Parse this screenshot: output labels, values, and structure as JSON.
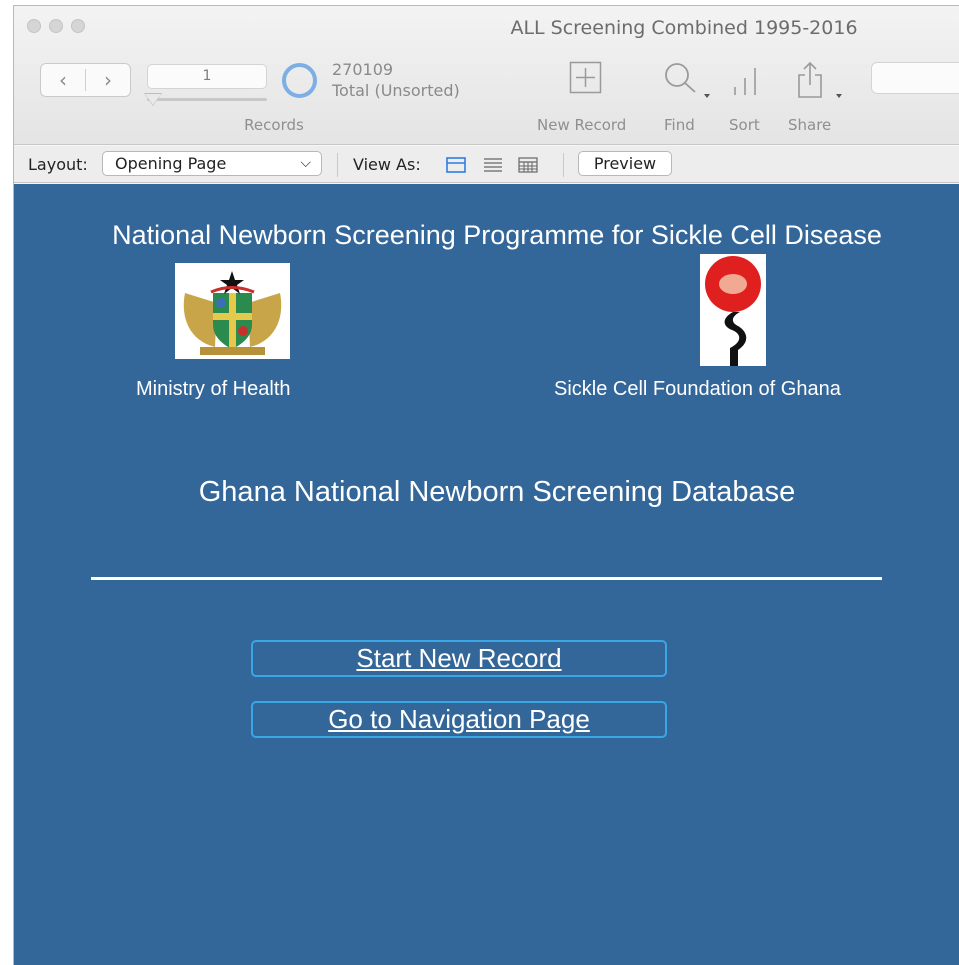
{
  "window": {
    "title": "ALL Screening Combined 1995-2016"
  },
  "toolbar": {
    "current_record": "1",
    "total_count": "270109",
    "sort_status": "Total (Unsorted)",
    "records_label": "Records",
    "new_record_label": "New Record",
    "find_label": "Find",
    "sort_label": "Sort",
    "share_label": "Share"
  },
  "layout_bar": {
    "layout_label": "Layout:",
    "layout_value": "Opening Page",
    "view_as_label": "View As:",
    "preview_label": "Preview"
  },
  "content": {
    "heading": "National Newborn Screening Programme for Sickle Cell Disease",
    "logo_left_caption": "Ministry of Health",
    "logo_right_caption": "Sickle Cell Foundation of Ghana",
    "database_title": "Ghana National Newborn Screening Database",
    "start_new_record": "Start New Record",
    "go_to_navigation": "Go to Navigation Page"
  },
  "colors": {
    "content_background": "#336699",
    "button_border": "#3aa6e6",
    "view_icon_active": "#2f7de1"
  }
}
